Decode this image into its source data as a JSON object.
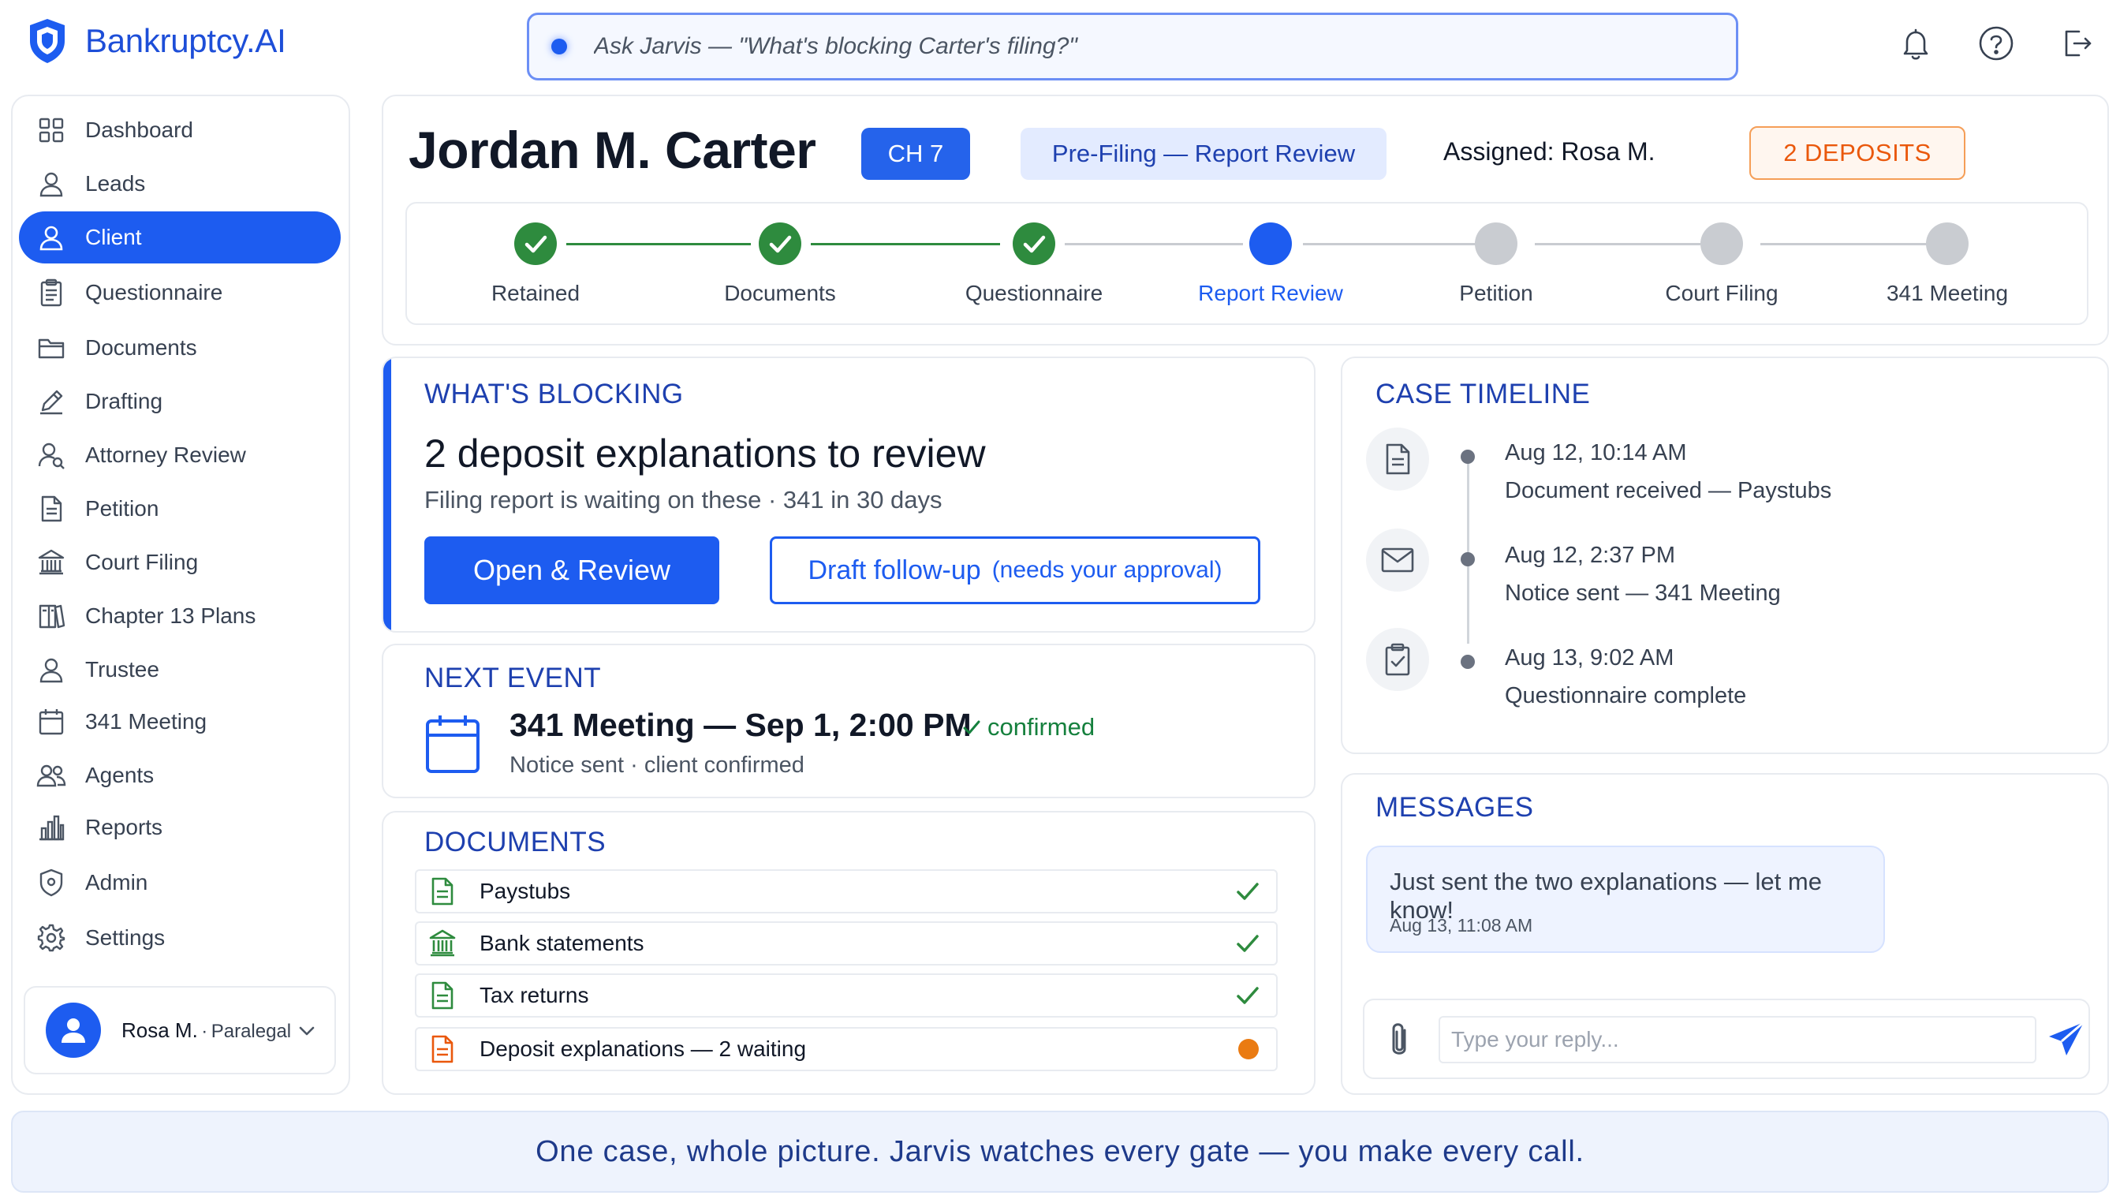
{
  "app": {
    "name": "Bankruptcy.AI"
  },
  "search": {
    "placeholder": "Ask Jarvis — \"What's blocking Carter's filing?\""
  },
  "sidebar": {
    "items": [
      {
        "label": "Dashboard",
        "icon": "grid-icon"
      },
      {
        "label": "Leads",
        "icon": "person-icon"
      },
      {
        "label": "Client",
        "icon": "person-icon",
        "active": true
      },
      {
        "label": "Questionnaire",
        "icon": "clipboard-icon"
      },
      {
        "label": "Documents",
        "icon": "folder-icon"
      },
      {
        "label": "Drafting",
        "icon": "pencil-icon"
      },
      {
        "label": "Attorney Review",
        "icon": "person-search-icon"
      },
      {
        "label": "Petition",
        "icon": "document-icon"
      },
      {
        "label": "Court Filing",
        "icon": "courthouse-icon"
      },
      {
        "label": "Chapter 13 Plans",
        "icon": "book-icon"
      },
      {
        "label": "Trustee",
        "icon": "person-icon"
      },
      {
        "label": "341 Meeting",
        "icon": "calendar-icon"
      },
      {
        "label": "Agents",
        "icon": "people-icon"
      },
      {
        "label": "Reports",
        "icon": "bar-chart-icon"
      },
      {
        "label": "Admin",
        "icon": "shield-icon"
      },
      {
        "label": "Settings",
        "icon": "gear-icon"
      }
    ],
    "user": {
      "name": "Rosa M.",
      "separator": "·",
      "role": "Paralegal"
    }
  },
  "client": {
    "name": "Jordan M. Carter",
    "chapter": "CH 7",
    "stage": "Pre-Filing — Report Review",
    "assigned": "Assigned: Rosa M.",
    "deposits_badge": "2 DEPOSITS"
  },
  "stepper": {
    "steps": [
      {
        "label": "Retained",
        "state": "done"
      },
      {
        "label": "Documents",
        "state": "done"
      },
      {
        "label": "Questionnaire",
        "state": "done"
      },
      {
        "label": "Report Review",
        "state": "current"
      },
      {
        "label": "Petition",
        "state": "pending"
      },
      {
        "label": "Court Filing",
        "state": "pending"
      },
      {
        "label": "341 Meeting",
        "state": "pending"
      }
    ]
  },
  "blocking": {
    "title": "WHAT'S BLOCKING",
    "headline": "2 deposit explanations to review",
    "subtitle": "Filing report is waiting on these  ·  341 in 30 days",
    "primary_button": "Open & Review",
    "secondary_button": "Draft follow-up",
    "secondary_note": "(needs your approval)"
  },
  "next_event": {
    "title": "NEXT EVENT",
    "event": "341 Meeting — Sep 1, 2:00 PM",
    "confirmed": "confirmed",
    "detail": "Notice sent  ·  client confirmed"
  },
  "documents": {
    "title": "DOCUMENTS",
    "rows": [
      {
        "name": "Paystubs",
        "status": "complete",
        "icon": "document-icon"
      },
      {
        "name": "Bank statements",
        "status": "complete",
        "icon": "bank-icon"
      },
      {
        "name": "Tax returns",
        "status": "complete",
        "icon": "document-icon"
      },
      {
        "name": "Deposit explanations — 2 waiting",
        "status": "waiting",
        "icon": "document-icon"
      }
    ]
  },
  "timeline": {
    "title": "CASE TIMELINE",
    "events": [
      {
        "time": "Aug 12, 10:14 AM",
        "desc": "Document received — Paystubs",
        "icon": "document-icon"
      },
      {
        "time": "Aug 12, 2:37 PM",
        "desc": "Notice sent — 341 Meeting",
        "icon": "mail-icon"
      },
      {
        "time": "Aug 13, 9:02 AM",
        "desc": "Questionnaire complete",
        "icon": "clipboard-check-icon"
      }
    ]
  },
  "messages": {
    "title": "MESSAGES",
    "items": [
      {
        "text": "Just sent the two explanations — let me know!",
        "time": "Aug 13, 11:08 AM"
      }
    ],
    "reply_placeholder": "Type your reply..."
  },
  "footer": {
    "tagline": "One case, whole picture. Jarvis watches every gate — you make every call."
  },
  "colors": {
    "primary": "#1d5cf0",
    "done": "#2e8b3e",
    "pending": "#c9ccd1",
    "warning": "#ea580c",
    "heading": "#1e40af"
  }
}
